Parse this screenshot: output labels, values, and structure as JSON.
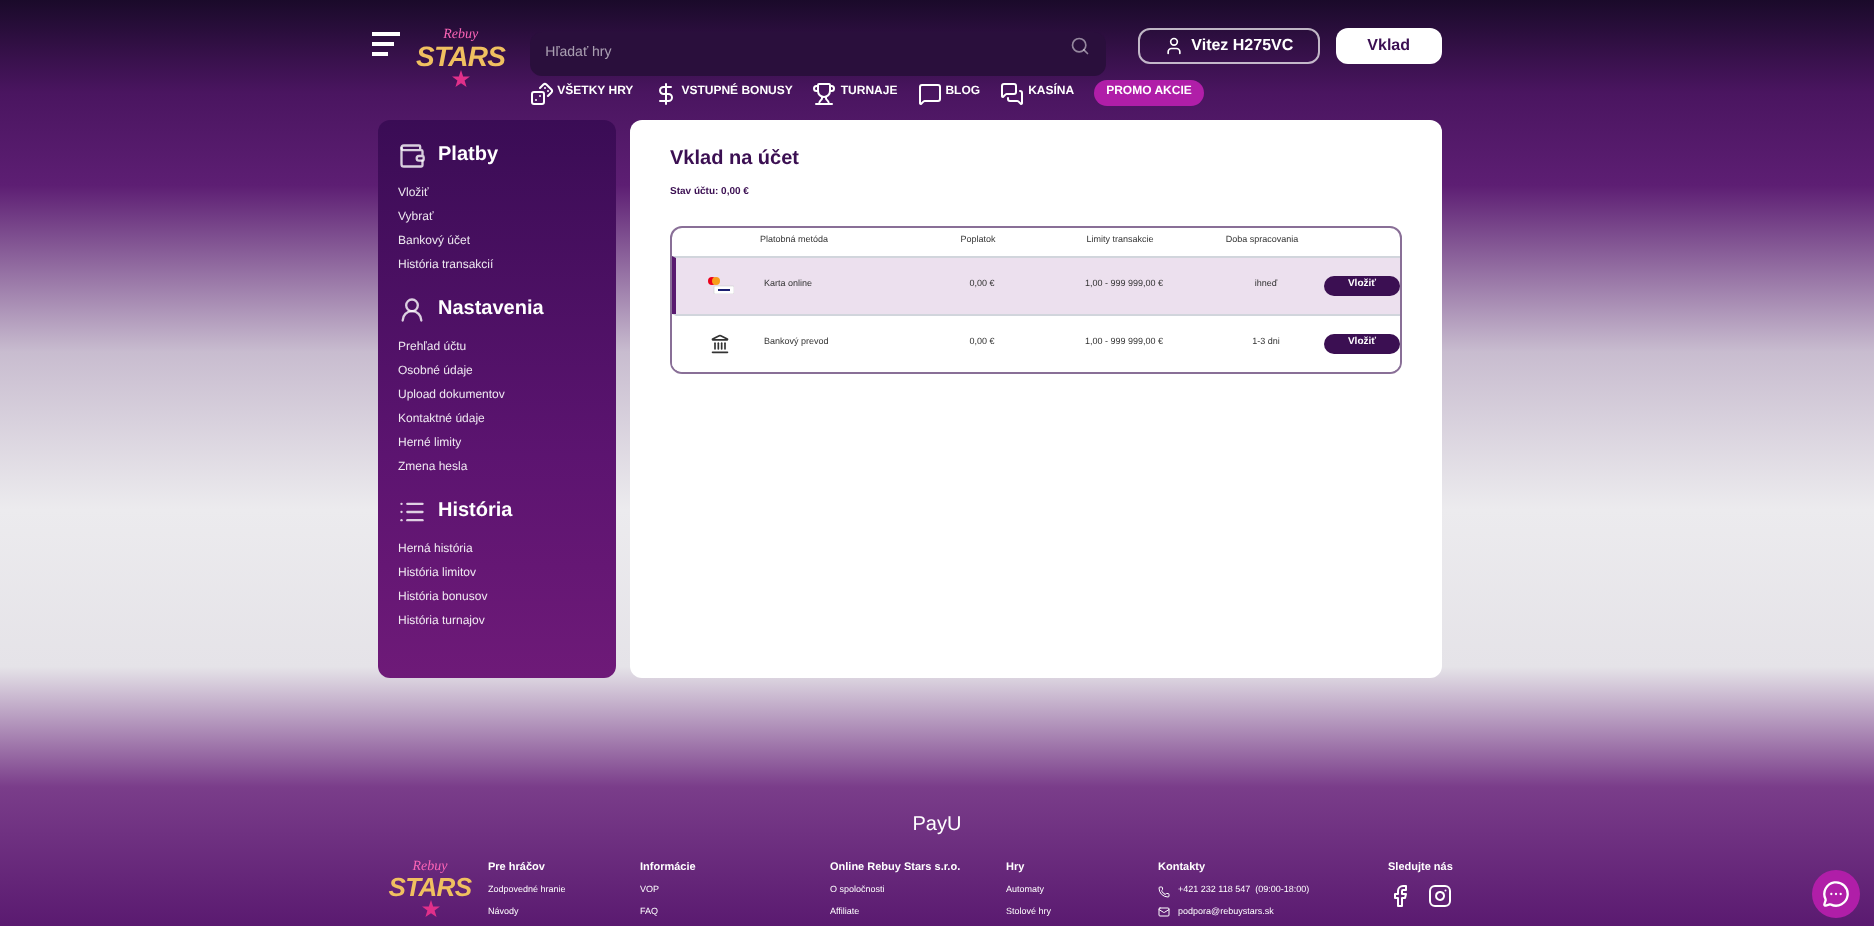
{
  "header": {
    "logo": {
      "top": "Rebuy",
      "main": "STARS"
    },
    "search": {
      "placeholder": "Hľadať hry"
    },
    "user_button": "Vitez H275VC",
    "deposit_button": "Vklad",
    "nav": [
      {
        "label": "VŠETKY HRY",
        "kind": "normal"
      },
      {
        "label": "VSTUPNÉ BONUSY",
        "kind": "normal"
      },
      {
        "label": "TURNAJE",
        "kind": "normal"
      },
      {
        "label": "BLOG",
        "kind": "normal"
      },
      {
        "label": "KASÍNA",
        "kind": "normal"
      },
      {
        "label": "PROMO AKCIE",
        "kind": "promo"
      }
    ]
  },
  "sidebar": [
    {
      "title": "Platby",
      "items": [
        "Vložiť",
        "Vybrať",
        "Bankový účet",
        "História transakcií"
      ]
    },
    {
      "title": "Nastavenia",
      "items": [
        "Prehľad účtu",
        "Osobné údaje",
        "Upload dokumentov",
        "Kontaktné údaje",
        "Herné limity",
        "Zmena hesla"
      ]
    },
    {
      "title": "História",
      "items": [
        "Herná história",
        "História limitov",
        "História bonusov",
        "História turnajov"
      ]
    }
  ],
  "main": {
    "title": "Vklad na účet",
    "balance": "Stav účtu: 0,00 €",
    "table": {
      "columns": [
        "Platobná metóda",
        "Poplatok",
        "Limity transakcie",
        "Doba spracovania"
      ],
      "rows": [
        {
          "kind": "card",
          "method": "Karta online",
          "fee": "0,00 €",
          "limits": "1,00 - 999 999,00 €",
          "time": "ihneď",
          "button": "Vložiť",
          "selected": true
        },
        {
          "kind": "bank",
          "method": "Bankový prevod",
          "fee": "0,00 €",
          "limits": "1,00 - 999 999,00 €",
          "time": "1-3 dni",
          "button": "Vložiť",
          "selected": false
        }
      ]
    }
  },
  "footer": {
    "payu": "PayU",
    "columns": [
      {
        "title": "Pre hráčov",
        "items": [
          "Zodpovedné hranie",
          "Návody"
        ]
      },
      {
        "title": "Informácie",
        "items": [
          "VOP",
          "FAQ"
        ]
      },
      {
        "title": "Online Rebuy Stars s.r.o.",
        "items": [
          "O spoločnosti",
          "Affiliate"
        ]
      },
      {
        "title": "Hry",
        "items": [
          "Automaty",
          "Stolové hry"
        ]
      }
    ],
    "contacts": {
      "title": "Kontakty",
      "phone": "+421 232 118 547  (09:00-18:00)",
      "email": "podpora@rebuystars.sk"
    },
    "social_title": "Sledujte nás",
    "logo": {
      "top": "Rebuy",
      "main": "STARS"
    }
  }
}
